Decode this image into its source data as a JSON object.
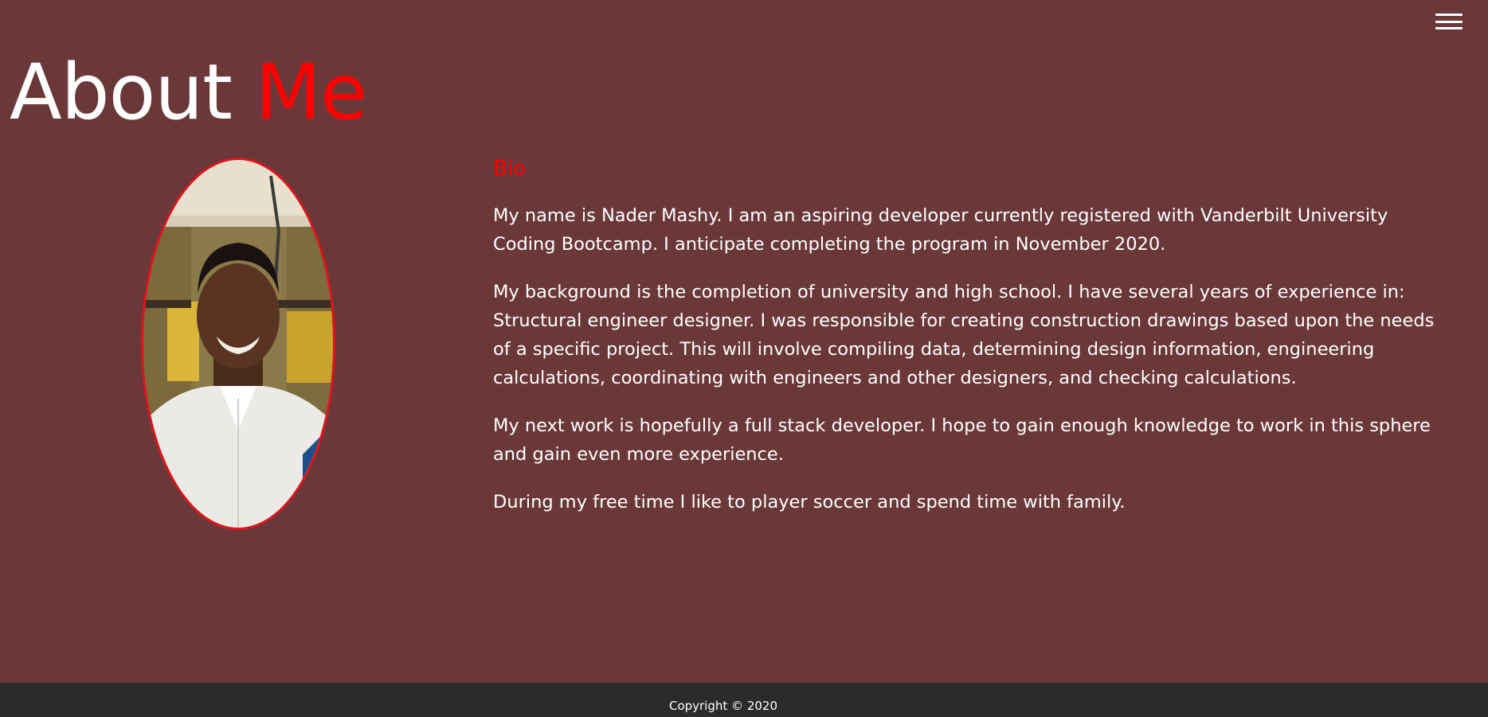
{
  "nav": {
    "menu_icon": "hamburger-menu-icon"
  },
  "header": {
    "title_main": "About",
    "title_accent": "Me",
    "accent_color": "#ff0000"
  },
  "profile": {
    "photo_icon": "profile-photo"
  },
  "bio": {
    "heading": "Bio",
    "paragraphs": [
      "My name is Nader Mashy. I am an aspiring developer currently registered with Vanderbilt University Coding Bootcamp. I anticipate completing the program in November 2020.",
      "My background is the completion of university and high school. I have several years of experience in: Structural engineer designer. I was responsible for creating construction drawings based upon the needs of a specific project. This will involve compiling data, determining design information, engineering calculations, coordinating with engineers and other designers, and checking calculations.",
      "My next work is hopefully a full stack developer. I hope to gain enough knowledge to work in this sphere and gain even more experience.",
      "During my free time I like to player soccer and spend time with family."
    ]
  },
  "footer": {
    "copyright": "Copyright © 2020"
  },
  "colors": {
    "page_background": "#6b383a",
    "footer_background": "#2b2b2b",
    "photo_border": "#e0141c"
  }
}
